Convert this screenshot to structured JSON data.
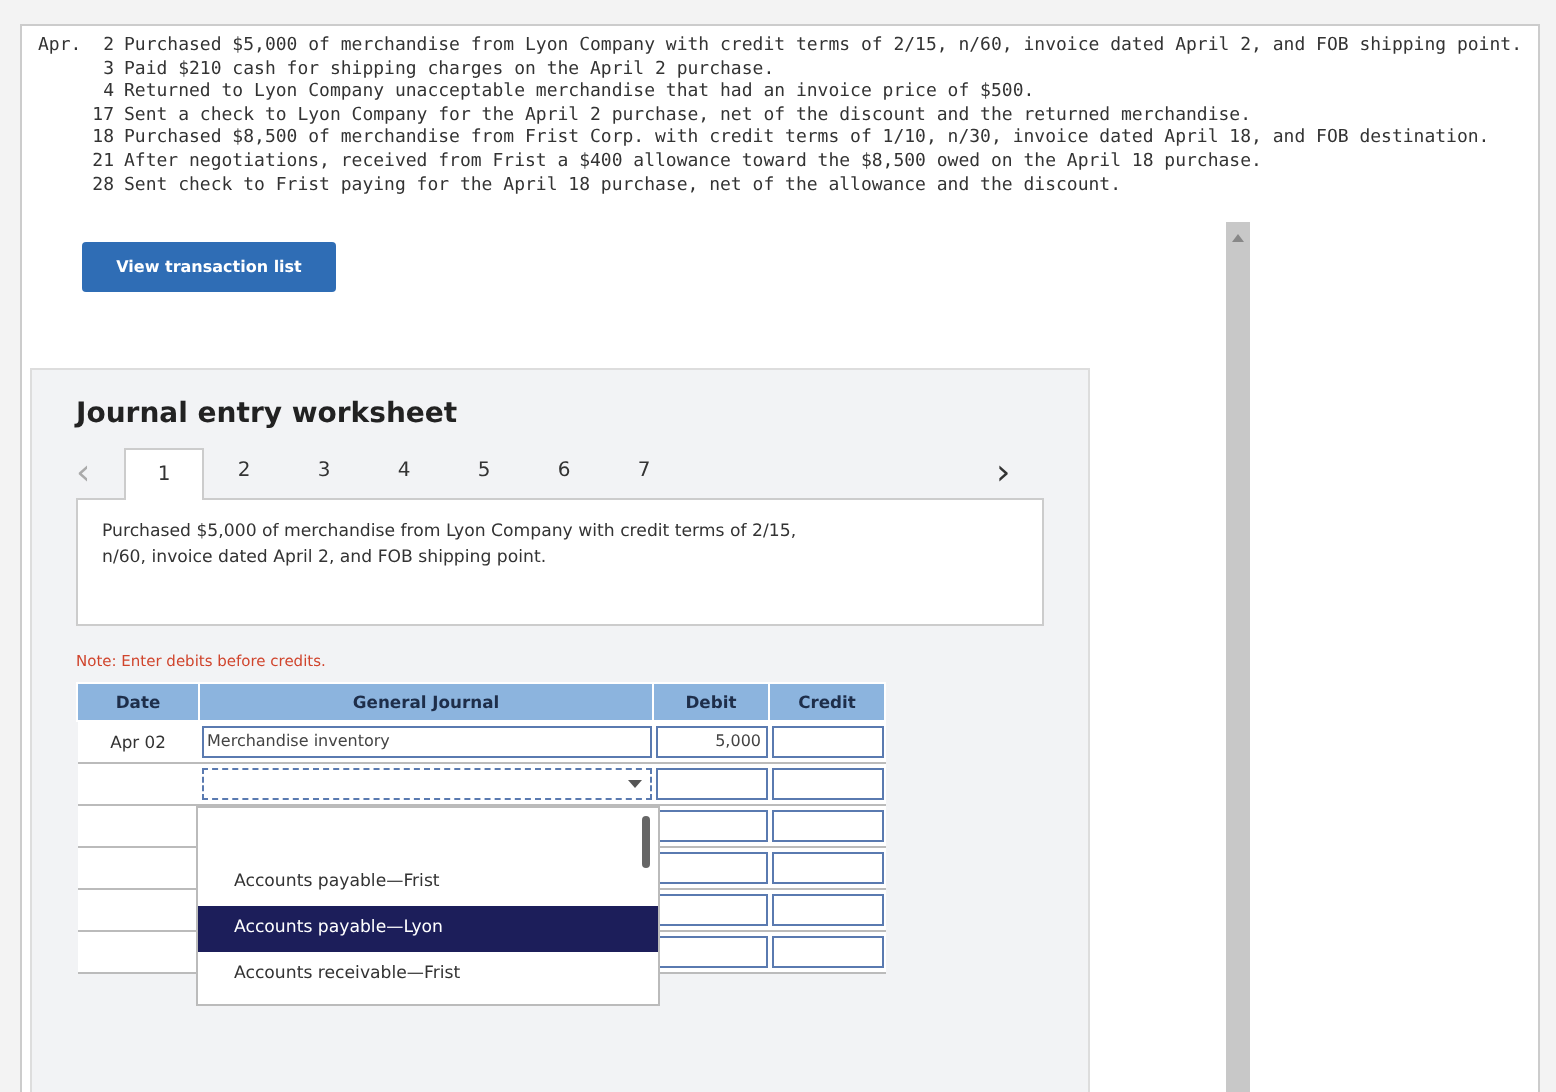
{
  "transactions": {
    "month": "Apr.",
    "items": [
      {
        "day": "2",
        "text": "Purchased $5,000 of merchandise from Lyon Company with credit terms of 2/15, n/60, invoice dated April 2, and FOB shipping point."
      },
      {
        "day": "3",
        "text": "Paid $210 cash for shipping charges on the April 2 purchase."
      },
      {
        "day": "4",
        "text": "Returned to Lyon Company unacceptable merchandise that had an invoice price of $500."
      },
      {
        "day": "17",
        "text": "Sent a check to Lyon Company for the April 2 purchase, net of the discount and the returned merchandise."
      },
      {
        "day": "18",
        "text": "Purchased $8,500 of merchandise from Frist Corp. with credit terms of 1/10, n/30, invoice dated April 18, and FOB destination."
      },
      {
        "day": "21",
        "text": "After negotiations, received from Frist a $400 allowance toward the $8,500 owed on the April 18 purchase."
      },
      {
        "day": "28",
        "text": "Sent check to Frist paying for the April 18 purchase, net of the allowance and the discount."
      }
    ]
  },
  "view_button": "View transaction list",
  "worksheet": {
    "title": "Journal entry worksheet",
    "prev": "‹",
    "next": "›",
    "tabs": [
      {
        "label": "1",
        "selected": true
      },
      {
        "label": "2",
        "selected": false
      },
      {
        "label": "3",
        "selected": false
      },
      {
        "label": "4",
        "selected": false
      },
      {
        "label": "5",
        "selected": false
      },
      {
        "label": "6",
        "selected": false
      },
      {
        "label": "7",
        "selected": false
      }
    ],
    "description": "Purchased $5,000 of merchandise from Lyon Company with credit terms of 2/15, n/60, invoice dated April 2, and FOB shipping point.",
    "note": "Note: Enter debits before credits.",
    "table": {
      "columns": [
        "Date",
        "General Journal",
        "Debit",
        "Credit"
      ],
      "rows": [
        {
          "kind": "entry",
          "date": "Apr 02",
          "account": "Merchandise inventory",
          "debit": "5,000"
        },
        {
          "kind": "select"
        },
        {
          "kind": "blank"
        },
        {
          "kind": "blank"
        },
        {
          "kind": "blank"
        },
        {
          "kind": "blank"
        }
      ]
    },
    "dropdown": [
      {
        "label": "Accounts payable—Frist",
        "selected": false
      },
      {
        "label": "Accounts payable—Lyon",
        "selected": true
      },
      {
        "label": "Accounts receivable—Frist",
        "selected": false
      }
    ]
  }
}
